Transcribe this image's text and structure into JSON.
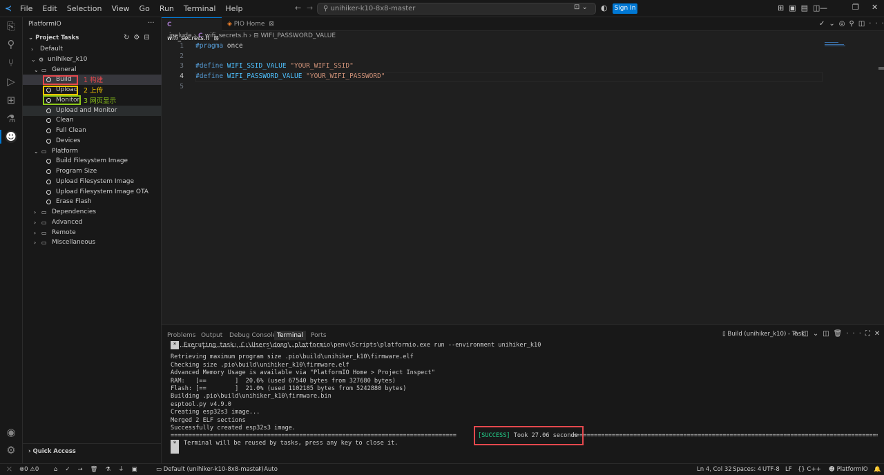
{
  "titlebar": {
    "menu": [
      "File",
      "Edit",
      "Selection",
      "View",
      "Go",
      "Run",
      "Terminal",
      "Help"
    ],
    "search": "unihiker-k10-8x8-master",
    "signin": "Sign In"
  },
  "sidebar": {
    "title": "PlatformIO",
    "section": "Project Tasks",
    "items": [
      {
        "label": "Default",
        "depth": 1,
        "chev": "›"
      },
      {
        "label": "unihiker_k10",
        "depth": 1,
        "chev": "⌄"
      },
      {
        "label": "General",
        "depth": 2,
        "chev": "⌄"
      },
      {
        "label": "Build",
        "depth": 3,
        "task": true
      },
      {
        "label": "Upload",
        "depth": 3,
        "task": true
      },
      {
        "label": "Monitor",
        "depth": 3,
        "task": true
      },
      {
        "label": "Upload and Monitor",
        "depth": 3,
        "task": true
      },
      {
        "label": "Clean",
        "depth": 3,
        "task": true
      },
      {
        "label": "Full Clean",
        "depth": 3,
        "task": true
      },
      {
        "label": "Devices",
        "depth": 3,
        "task": true
      },
      {
        "label": "Platform",
        "depth": 2,
        "chev": "⌄"
      },
      {
        "label": "Build Filesystem Image",
        "depth": 3,
        "task": true
      },
      {
        "label": "Program Size",
        "depth": 3,
        "task": true
      },
      {
        "label": "Upload Filesystem Image",
        "depth": 3,
        "task": true
      },
      {
        "label": "Upload Filesystem Image OTA",
        "depth": 3,
        "task": true
      },
      {
        "label": "Erase Flash",
        "depth": 3,
        "task": true
      },
      {
        "label": "Dependencies",
        "depth": 2,
        "chev": "›"
      },
      {
        "label": "Advanced",
        "depth": 2,
        "chev": "›"
      },
      {
        "label": "Remote",
        "depth": 2,
        "chev": "›"
      },
      {
        "label": "Miscellaneous",
        "depth": 2,
        "chev": "›"
      }
    ],
    "annotations": [
      "1 构建",
      "2 上传",
      "3 网页显示"
    ],
    "quick_access": "Quick Access"
  },
  "tabs": [
    {
      "label": "wifi_secrets.h",
      "icon": "C"
    },
    {
      "label": "PIO Home",
      "icon": "pio"
    }
  ],
  "breadcrumb": [
    "include",
    "wifi_secrets.h",
    "WIFI_PASSWORD_VALUE"
  ],
  "code": [
    {
      "n": "1",
      "parts": [
        [
          "#pragma",
          "kw"
        ],
        [
          " once",
          "kw2"
        ]
      ]
    },
    {
      "n": "2",
      "parts": []
    },
    {
      "n": "3",
      "parts": [
        [
          "#define",
          "kw"
        ],
        [
          " WIFI_SSID_VALUE ",
          "def"
        ],
        [
          "\"YOUR_WIFI_SSID\"",
          "str"
        ]
      ]
    },
    {
      "n": "4",
      "parts": [
        [
          "#define",
          "kw"
        ],
        [
          " WIFI_PASSWORD_VALUE ",
          "def"
        ],
        [
          "\"YOUR_WIFI_PASSWORD\"",
          "str"
        ]
      ]
    },
    {
      "n": "5",
      "parts": []
    }
  ],
  "panel": {
    "tabs": [
      "Problems",
      "Output",
      "Debug Console",
      "Terminal",
      "Ports"
    ],
    "active": "Terminal",
    "task_label": "Build (unihiker_k10) - Task"
  },
  "terminal": {
    "header": "Executing task: C:\\Users\\dong\\.platformio\\penv\\Scripts\\platformio.exe run --environment unihiker_k10",
    "lines": [
      "Linking .pio\\build\\unihiker_k10\\firmware.elf",
      "Retrieving maximum program size .pio\\build\\unihiker_k10\\firmware.elf",
      "Checking size .pio\\build\\unihiker_k10\\firmware.elf",
      "Advanced Memory Usage is available via \"PlatformIO Home > Project Inspect\"",
      "RAM:   [==        ]  20.6% (used 67540 bytes from 327680 bytes)",
      "Flash: [==        ]  21.0% (used 1102185 bytes from 5242880 bytes)",
      "Building .pio\\build\\unihiker_k10\\firmware.bin",
      "esptool.py v4.9.0",
      "Creating esp32s3 image...",
      "Merged 2 ELF sections",
      "Successfully created esp32s3 image."
    ],
    "success_tag": "[SUCCESS]",
    "success_text": " Took 27.06 seconds ",
    "footer": "Terminal will be reused by tasks, press any key to close it."
  },
  "statusbar": {
    "errors": "0",
    "warnings": "0",
    "env": "Default (unihiker-k10-8x8-master)",
    "auto": "Auto",
    "position": "Ln 4, Col 32",
    "spaces": "Spaces: 4",
    "encoding": "UTF-8",
    "eol": "LF",
    "lang": "C++",
    "pio": "PlatformIO"
  },
  "colors": {
    "kw": "#569cd6",
    "def": "#4fc1ff",
    "str": "#ce9178",
    "success": "#23d18b",
    "accent": "#0078d4",
    "annot_red": "#e5484d",
    "annot_yellow": "#f2c500",
    "annot_green": "#8ec91a"
  }
}
